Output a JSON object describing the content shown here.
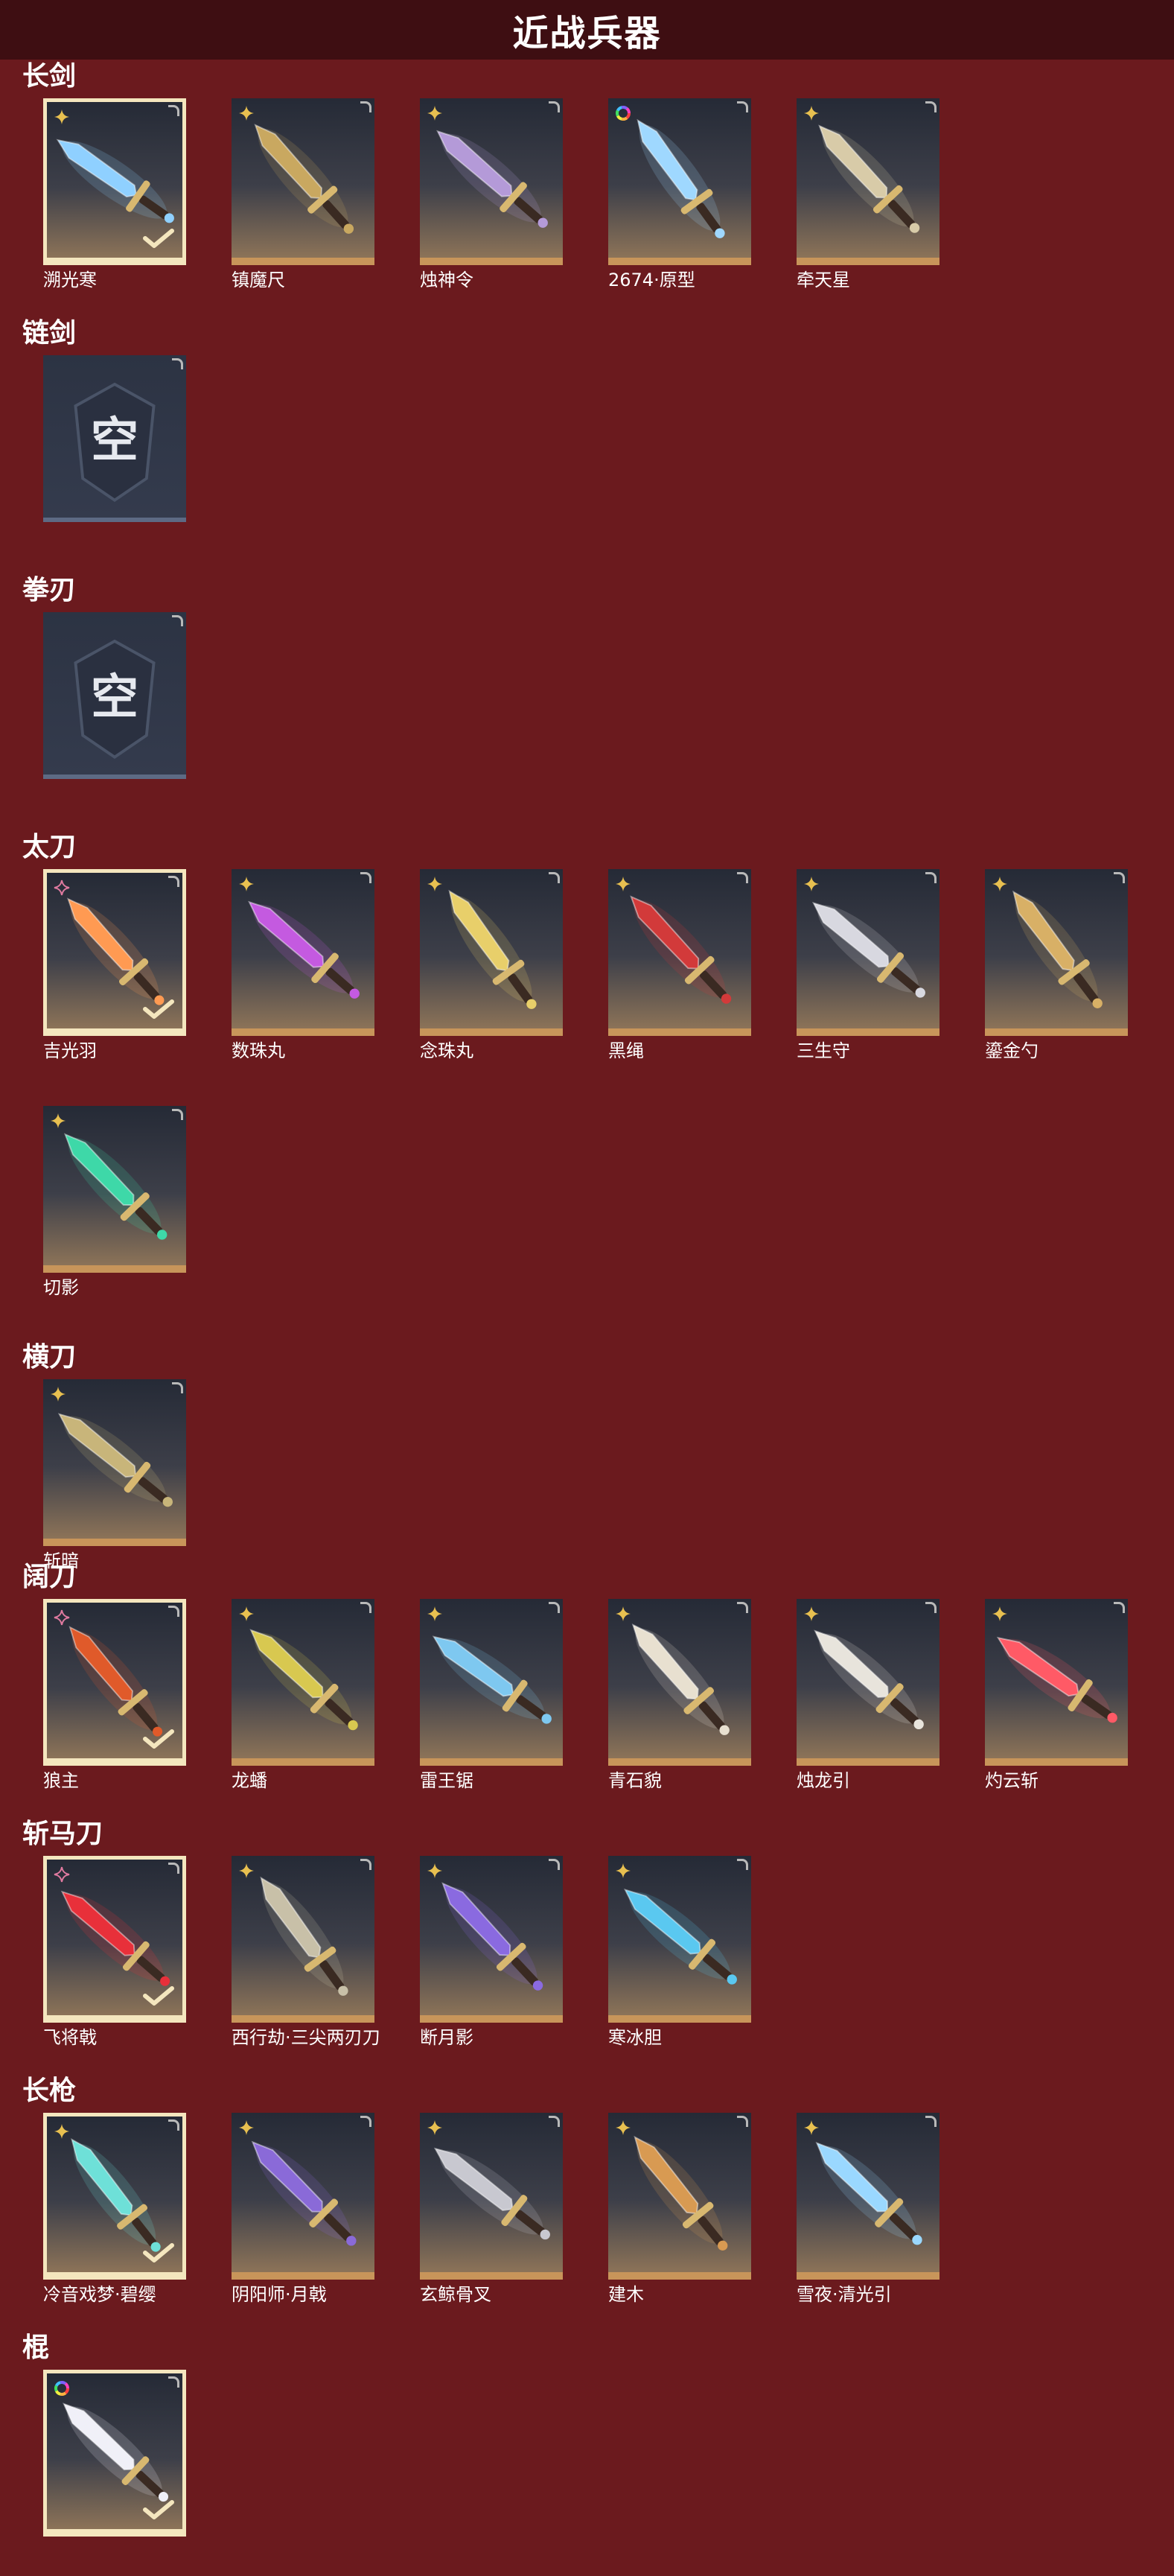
{
  "page": {
    "title": "近战兵器"
  },
  "colors": {
    "background": "#6b1a1e",
    "title_bar": "#3e0e12",
    "card_border": "#c8955a",
    "selected_border": "#f4e6be",
    "gold_badge": "#e8c050",
    "pink_badge": "#e07aa0"
  },
  "categories": [
    {
      "label": "长剑",
      "items": [
        {
          "name": "溯光寒",
          "badge": "gold",
          "selected": true,
          "color": "#8fd0ff"
        },
        {
          "name": "镇魔尺",
          "badge": "gold",
          "selected": false,
          "color": "#c9a860"
        },
        {
          "name": "烛神令",
          "badge": "gold",
          "selected": false,
          "color": "#b49ad8"
        },
        {
          "name": "2674·原型",
          "badge": "rainbow",
          "selected": false,
          "color": "#9fd8ff"
        },
        {
          "name": "牵天星",
          "badge": "gold",
          "selected": false,
          "color": "#d8cba8"
        }
      ]
    },
    {
      "label": "链剑",
      "items": [
        {
          "name": "",
          "empty": true,
          "empty_text": "空"
        }
      ]
    },
    {
      "label": "拳刃",
      "items": [
        {
          "name": "",
          "empty": true,
          "empty_text": "空"
        }
      ]
    },
    {
      "label": "太刀",
      "items": [
        {
          "name": "吉光羽",
          "badge": "pink",
          "selected": true,
          "color": "#ff9a52"
        },
        {
          "name": "数珠丸",
          "badge": "gold",
          "selected": false,
          "color": "#c45ae0"
        },
        {
          "name": "念珠丸",
          "badge": "gold",
          "selected": false,
          "color": "#e8cf6a"
        },
        {
          "name": "黑绳",
          "badge": "gold",
          "selected": false,
          "color": "#d23a3a"
        },
        {
          "name": "三生守",
          "badge": "gold",
          "selected": false,
          "color": "#d8d8e0"
        },
        {
          "name": "鎏金勺",
          "badge": "gold",
          "selected": false,
          "color": "#d8b066"
        },
        {
          "name": "切影",
          "badge": "gold",
          "selected": false,
          "color": "#3ed8a8"
        }
      ]
    },
    {
      "label": "横刀",
      "items": [
        {
          "name": "斩暗",
          "badge": "gold",
          "selected": false,
          "color": "#c8b57a"
        }
      ]
    },
    {
      "label": "阔刀",
      "items": [
        {
          "name": "狼主",
          "badge": "pink",
          "selected": true,
          "color": "#e05a2a"
        },
        {
          "name": "龙蟠",
          "badge": "gold",
          "selected": false,
          "color": "#d8c850"
        },
        {
          "name": "雷王锯",
          "badge": "gold",
          "selected": false,
          "color": "#7ec8f0"
        },
        {
          "name": "青石貌",
          "badge": "gold",
          "selected": false,
          "color": "#e8e0d0"
        },
        {
          "name": "烛龙引",
          "badge": "gold",
          "selected": false,
          "color": "#e8e4dc"
        },
        {
          "name": "灼云斩",
          "badge": "gold",
          "selected": false,
          "color": "#ff5a66"
        }
      ]
    },
    {
      "label": "斩马刀",
      "items": [
        {
          "name": "飞将戟",
          "badge": "pink",
          "selected": true,
          "color": "#e8303a"
        },
        {
          "name": "西行劫·三尖两刃刀",
          "badge": "gold",
          "selected": false,
          "color": "#c8c0a8"
        },
        {
          "name": "断月影",
          "badge": "gold",
          "selected": false,
          "color": "#8a6ae0"
        },
        {
          "name": "寒冰胆",
          "badge": "gold",
          "selected": false,
          "color": "#5ac8f0"
        }
      ]
    },
    {
      "label": "长枪",
      "items": [
        {
          "name": "冷音戏梦·碧缨",
          "badge": "gold",
          "selected": true,
          "color": "#6ee0d8"
        },
        {
          "name": "阴阳师·月戟",
          "badge": "gold",
          "selected": false,
          "color": "#8a6ad8"
        },
        {
          "name": "玄鲸骨叉",
          "badge": "gold",
          "selected": false,
          "color": "#c8c8d0"
        },
        {
          "name": "建木",
          "badge": "gold",
          "selected": false,
          "color": "#d89a52"
        },
        {
          "name": "雪夜·清光引",
          "badge": "gold",
          "selected": false,
          "color": "#9ad8ff"
        }
      ]
    },
    {
      "label": "棍",
      "items": [
        {
          "name": "",
          "badge": "rainbow",
          "selected": true,
          "color": "#f0f0f8"
        }
      ]
    }
  ]
}
